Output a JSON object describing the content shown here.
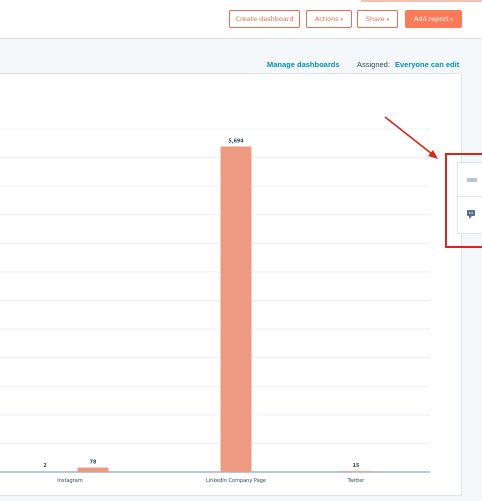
{
  "toolbar": {
    "create_dashboard": "Create dashboard",
    "actions": "Actions",
    "share": "Share",
    "add_report": "Add report",
    "caret": "▾"
  },
  "subheader": {
    "manage_dashboards": "Manage dashboards",
    "assigned_label": "Assigned:",
    "assigned_value": "Everyone can edit"
  },
  "side_widget": {
    "icons": [
      "grid-dots-icon",
      "comment-icon"
    ]
  },
  "colors": {
    "bar": "#ee9a80",
    "accent": "#ff7a59",
    "link": "#0091ae",
    "annotation": "#d9261c"
  },
  "chart_data": {
    "type": "bar",
    "categories": [
      "Instagram",
      "LinkedIn Company Page",
      "Twitter"
    ],
    "series": [
      {
        "values": [
          2,
          null,
          null
        ]
      },
      {
        "values": [
          78,
          5694,
          15
        ]
      }
    ],
    "data_labels": [
      "2",
      "78",
      "5,694",
      "15"
    ],
    "grid": true
  }
}
